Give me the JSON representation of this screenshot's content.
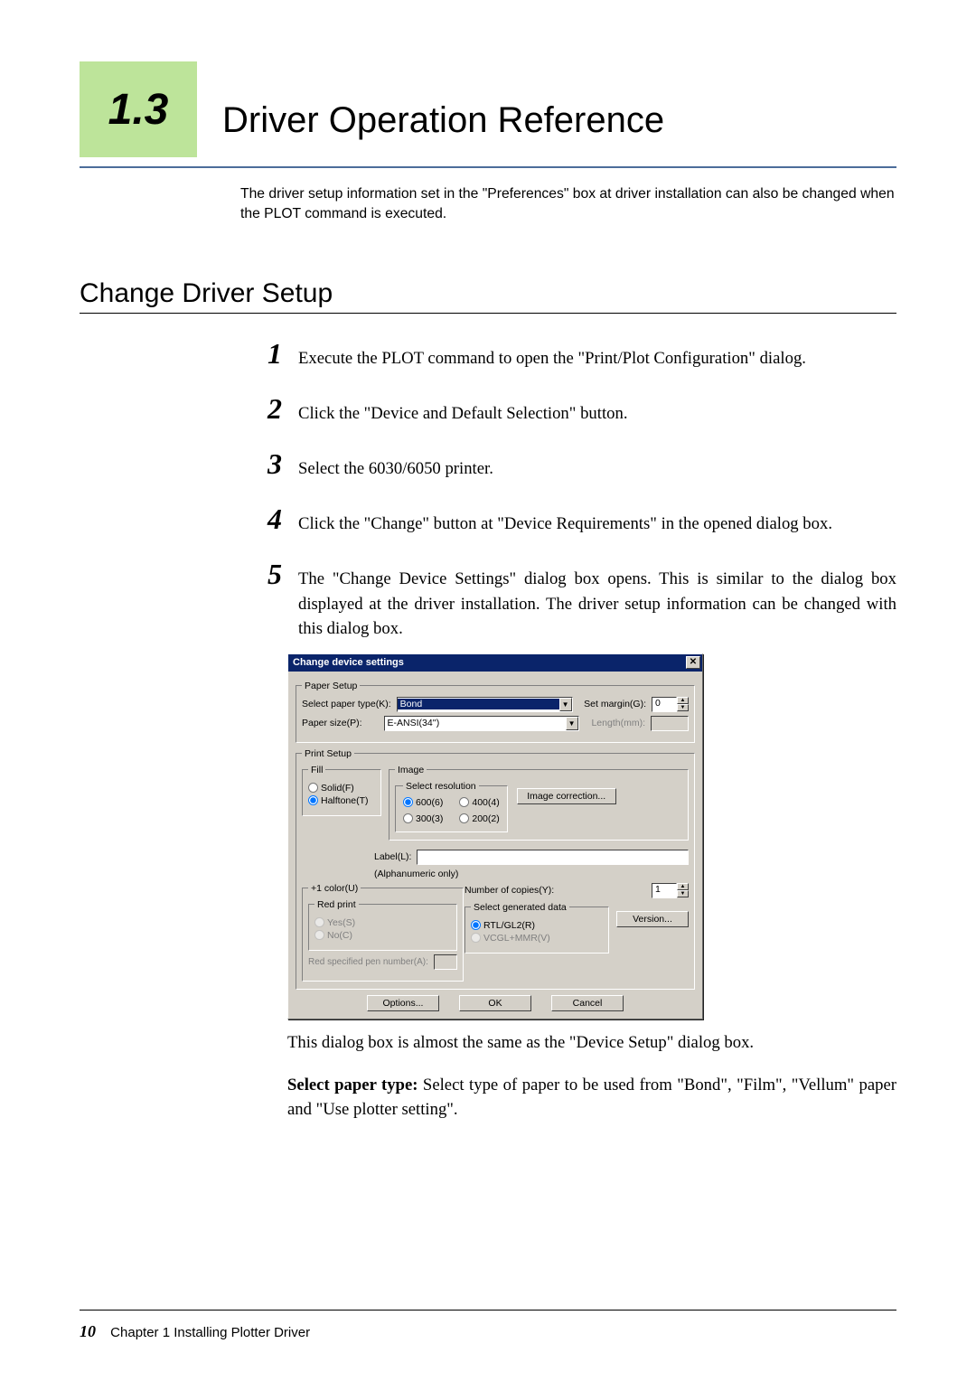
{
  "header": {
    "section_number": "1.3",
    "section_title": "Driver Operation Reference"
  },
  "intro": "The driver setup information set in the \"Preferences\" box at driver installation can also be changed when the PLOT command is executed.",
  "subsection": "Change Driver Setup",
  "steps": {
    "s1": {
      "num": "1",
      "text": "Execute the PLOT command to open the \"Print/Plot Configuration\" dialog."
    },
    "s2": {
      "num": "2",
      "text": "Click the \"Device and Default Selection\" button."
    },
    "s3": {
      "num": "3",
      "text": "Select the 6030/6050 printer."
    },
    "s4": {
      "num": "4",
      "text": "Click the \"Change\" button at \"Device Requirements\" in the opened dialog box."
    },
    "s5": {
      "num": "5",
      "text": "The \"Change Device Settings\" dialog box opens. This is similar to the dialog box displayed at the driver installation. The driver setup information can be changed with this dialog box."
    }
  },
  "followup1": "This dialog box is almost the same as the \"Device Setup\" dialog box.",
  "followup2_bold": "Select paper type:",
  "followup2_rest": " Select type of paper to be used from \"Bond\", \"Film\", \"Vellum\" paper and \"Use plotter setting\".",
  "footer": {
    "page": "10",
    "chapter": "Chapter 1  Installing Plotter Driver"
  },
  "dialog": {
    "title": "Change device settings",
    "close_glyph": "✕",
    "groups": {
      "paper_setup": "Paper Setup",
      "print_setup": "Print Setup",
      "fill": "Fill",
      "image": "Image",
      "select_resolution": "Select resolution",
      "plus1_color": "+1 color(U)",
      "red_print": "Red print",
      "select_gen_data": "Select generated data"
    },
    "labels": {
      "select_paper_type": "Select paper type(K):",
      "set_margin": "Set margin(G):",
      "paper_size": "Paper size(P):",
      "length_mm": "Length(mm):",
      "label": "Label(L):",
      "alpha_only": "(Alphanumeric only)",
      "red_pen": "Red specified pen number(A):",
      "num_copies": "Number of copies(Y):"
    },
    "values": {
      "paper_type": "Bond",
      "margin": "0",
      "paper_size": "E-ANSI(34'')",
      "length": "",
      "label": "",
      "red_pen": "",
      "copies": "1"
    },
    "radios": {
      "solid": "Solid(F)",
      "halftone": "Halftone(T)",
      "r600": "600(6)",
      "r400": "400(4)",
      "r300": "300(3)",
      "r200": "200(2)",
      "yes": "Yes(S)",
      "no": "No(C)",
      "rtl": "RTL/GL2(R)",
      "vcgl": "VCGL+MMR(V)"
    },
    "buttons": {
      "image_correction": "Image correction...",
      "version": "Version...",
      "options": "Options...",
      "ok": "OK",
      "cancel": "Cancel"
    }
  }
}
